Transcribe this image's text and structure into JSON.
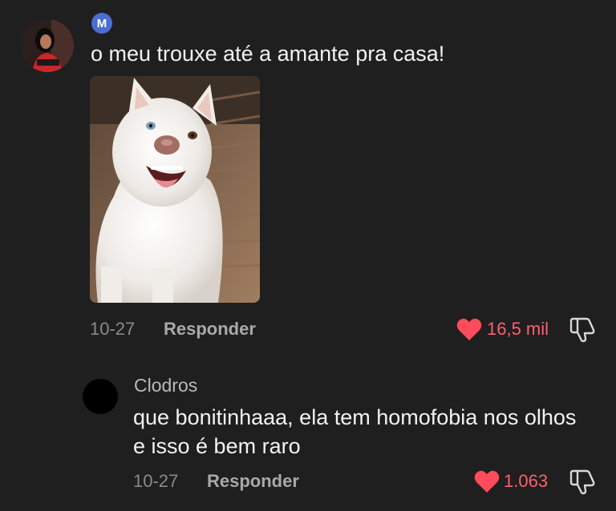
{
  "comment": {
    "badge_letter": "M",
    "text": "o meu trouxe até a amante pra casa!",
    "date": "10-27",
    "reply_label": "Responder",
    "likes": "16,5 mil"
  },
  "reply_comment": {
    "username": "Clodros",
    "text": "que bonitinhaaa, ela tem homofobia nos olhos e isso é bem raro",
    "date": "10-27",
    "reply_label": "Responder",
    "likes": "1.063"
  },
  "colors": {
    "background": "#1f1f1f",
    "like_accent": "#ff5f6d",
    "heart": "#ff4b5c",
    "badge": "#4a6fd1"
  },
  "icons": [
    "heart-icon",
    "dislike-icon"
  ]
}
